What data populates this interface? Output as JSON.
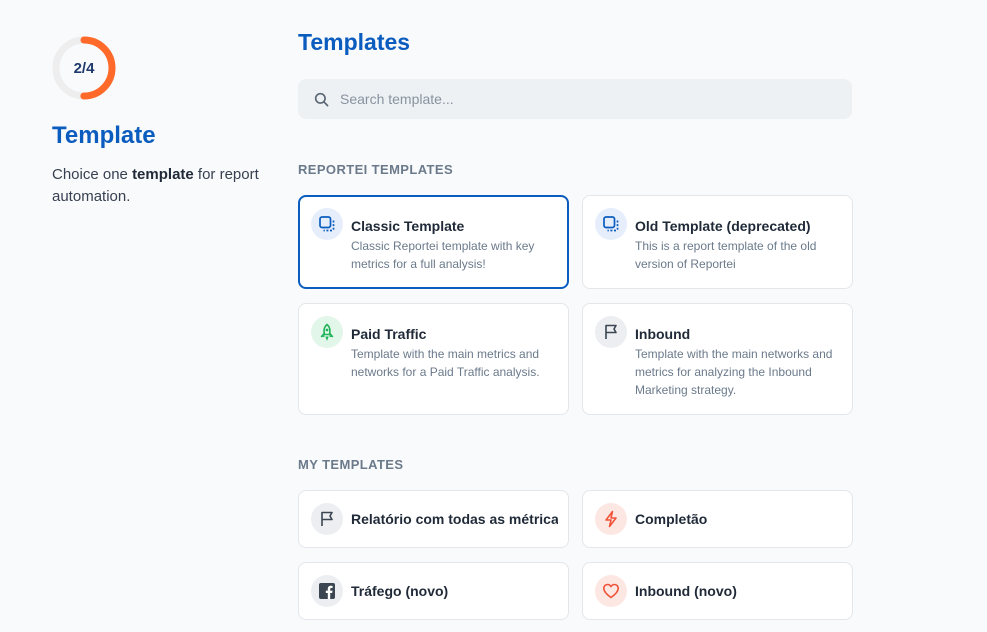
{
  "progress": {
    "label": "2/4",
    "fraction": 0.5,
    "color": "#ff6a2b",
    "track": "#eeeeee"
  },
  "step": {
    "title": "Template",
    "desc_prefix": "Choice one ",
    "desc_bold": "template",
    "desc_suffix": " for report automation."
  },
  "page": {
    "title": "Templates"
  },
  "search": {
    "placeholder": "Search template...",
    "icon": "search-icon"
  },
  "sections": {
    "reportei": {
      "heading": "REPORTEI TEMPLATES",
      "cards": [
        {
          "title": "Classic Template",
          "desc": "Classic Reportei template with key metrics for a full analysis!",
          "icon": "template-copy-icon",
          "selected": true
        },
        {
          "title": "Old Template (deprecated)",
          "desc": "This is a report template of the old version of Reportei",
          "icon": "template-copy-icon",
          "selected": false
        },
        {
          "title": "Paid Traffic",
          "desc": "Template with the main metrics and networks for a Paid Traffic analysis.",
          "icon": "rocket-icon",
          "selected": false
        },
        {
          "title": "Inbound",
          "desc": "Template with the main networks and metrics for analyzing the Inbound Marketing strategy.",
          "icon": "flag-icon",
          "selected": false
        }
      ]
    },
    "mine": {
      "heading": "MY TEMPLATES",
      "cards": [
        {
          "title": "Relatório com todas as métricas",
          "icon": "flag-icon"
        },
        {
          "title": "Completão",
          "icon": "lightning-icon"
        },
        {
          "title": "Tráfego (novo)",
          "icon": "facebook-icon"
        },
        {
          "title": "Inbound (novo)",
          "icon": "heart-icon"
        }
      ]
    }
  },
  "colors": {
    "accent": "#0b5cbf",
    "progress": "#ff6a2b",
    "green": "#22b45b",
    "red": "#f0533a"
  }
}
